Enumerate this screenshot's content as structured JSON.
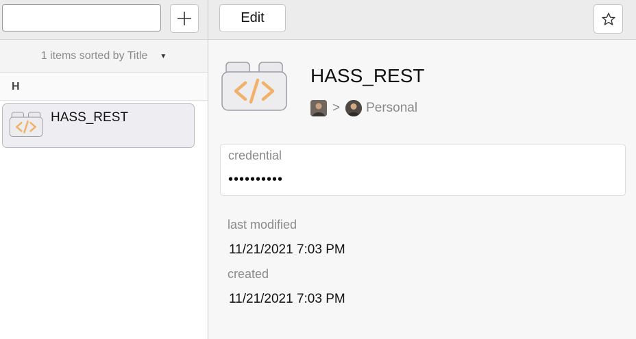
{
  "search": {
    "value": "",
    "placeholder": ""
  },
  "toolbar": {
    "add_icon": "plus-icon",
    "edit_label": "Edit",
    "favorite_icon": "star-icon"
  },
  "list": {
    "sort_label": "1 items sorted by Title",
    "sort_caret": "▼",
    "section_letter": "H",
    "items": [
      {
        "title": "HASS_REST",
        "icon": "api-credential-icon"
      }
    ]
  },
  "detail": {
    "title": "HASS_REST",
    "icon": "api-credential-icon",
    "breadcrumb": {
      "separator": ">",
      "vault": "Personal"
    },
    "fields": [
      {
        "label": "credential",
        "value": "••••••••••"
      }
    ],
    "meta": {
      "last_modified_label": "last modified",
      "last_modified_value": "11/21/2021 7:03 PM",
      "created_label": "created",
      "created_value": "11/21/2021 7:03 PM"
    }
  },
  "colors": {
    "accent_orange": "#f0b26a",
    "icon_fill": "#e9e9ec",
    "icon_stroke": "#9b9ba3"
  }
}
